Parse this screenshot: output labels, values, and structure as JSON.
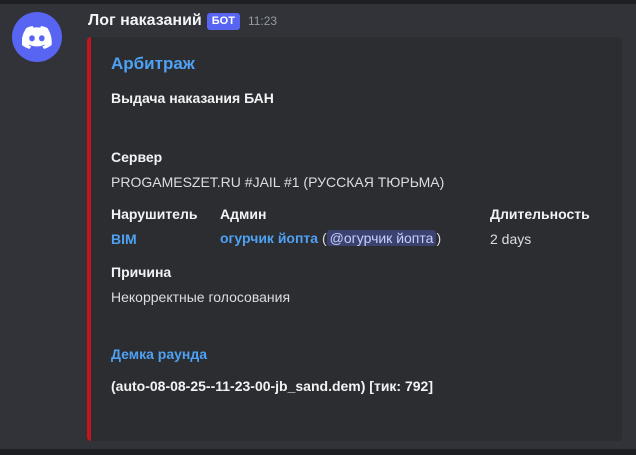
{
  "message": {
    "author": "Лог наказаний",
    "bot_tag": "БОТ",
    "time": "11:23"
  },
  "embed": {
    "accent_color": "#c4151c",
    "title": "Арбитраж",
    "description": "Выдача наказания БАН",
    "server": {
      "name": "Сервер",
      "value": "PROGAMESZET.RU #JAIL #1 (РУССКАЯ ТЮРЬМА)"
    },
    "offender": {
      "name": "Нарушитель",
      "value": "BIM"
    },
    "admin": {
      "name": "Админ",
      "link": "огурчик йопта",
      "open_paren": "(",
      "mention": "@огурчик йопта",
      "close_paren": ")"
    },
    "duration": {
      "name": "Длительность",
      "value": "2 days"
    },
    "reason": {
      "name": "Причина",
      "value": "Некорректные голосования"
    },
    "demo": {
      "name": "Демка раунда",
      "value": "(auto-08-08-25--11-23-00-jb_sand.dem) [тик: 792]"
    }
  },
  "icons": {
    "avatar": "discord-logo-icon"
  },
  "colors": {
    "background": "#313338",
    "embed_background": "#2b2d31",
    "link": "#4ea1f3",
    "bot_tag": "#5865f2"
  }
}
